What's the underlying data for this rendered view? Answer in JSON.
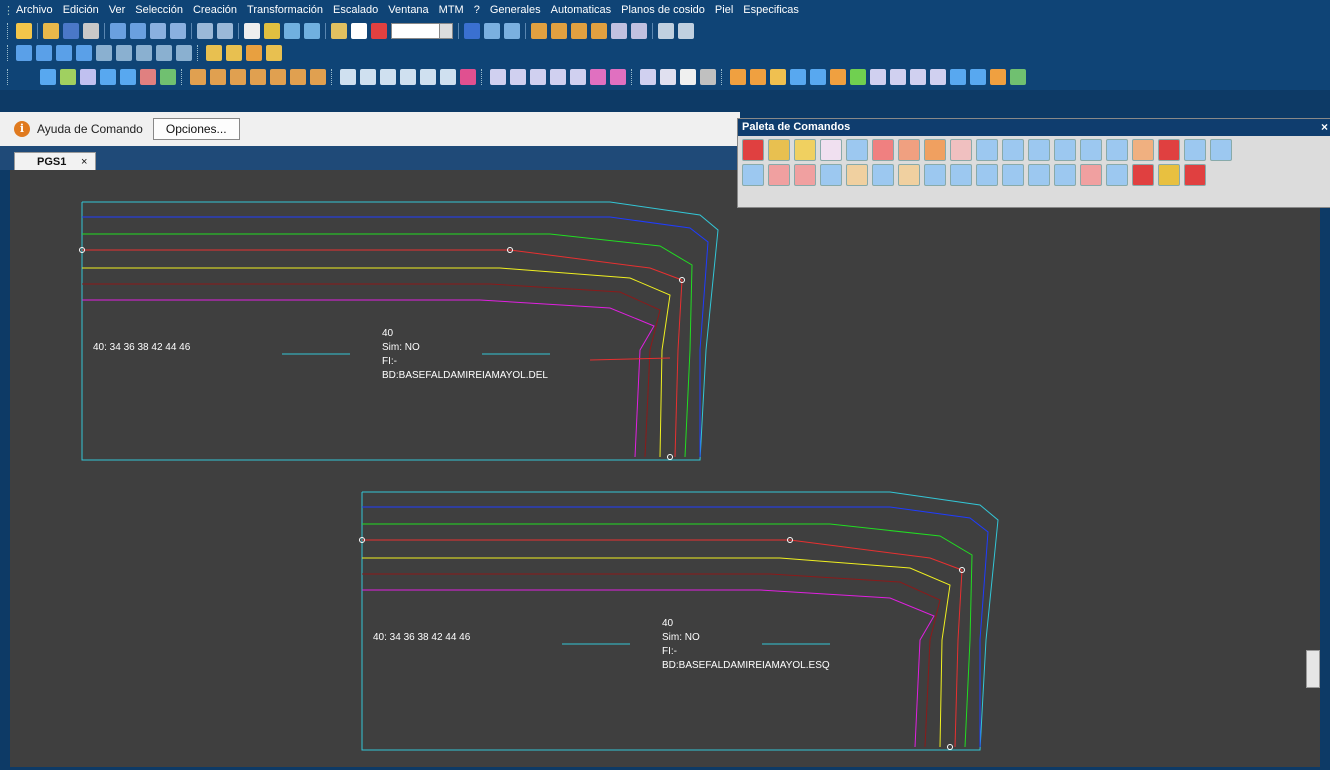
{
  "menu": [
    "Archivo",
    "Edición",
    "Ver",
    "Selección",
    "Creación",
    "Transformación",
    "Escalado",
    "Ventana",
    "MTM",
    "?",
    "Generales",
    "Automaticas",
    "Planos de cosido",
    "Piel",
    "Especificas"
  ],
  "toolbar": {
    "line_style_value": "-----------"
  },
  "command_bar": {
    "info_icon": "info-icon",
    "label": "Ayuda de Comando",
    "options_label": "Opciones..."
  },
  "tabs": [
    {
      "label": "PGS1",
      "close": "×"
    }
  ],
  "palette": {
    "title": "Paleta de Comandos",
    "close": "×"
  },
  "pieces": [
    {
      "sizes": "40: 34 36 38 42 44 46",
      "size": "40",
      "sim": "Sim: NO",
      "fi": "FI:-",
      "bd": "BD:BASEFALDAMIREIAMAYOL.DEL"
    },
    {
      "sizes": "40: 34 36 38 42 44 46",
      "size": "40",
      "sim": "Sim: NO",
      "fi": "FI:-",
      "bd": "BD:BASEFALDAMIREIAMAYOL.ESQ"
    }
  ],
  "colors": {
    "outline": "#33c6d6",
    "size_lines": [
      "#1f3cff",
      "#22dd22",
      "#e83030",
      "#f0f020",
      "#8b1a1a",
      "#e020e0"
    ],
    "canvas_bg": "#3f3f3f",
    "title_bar": "#0f3d6e"
  }
}
